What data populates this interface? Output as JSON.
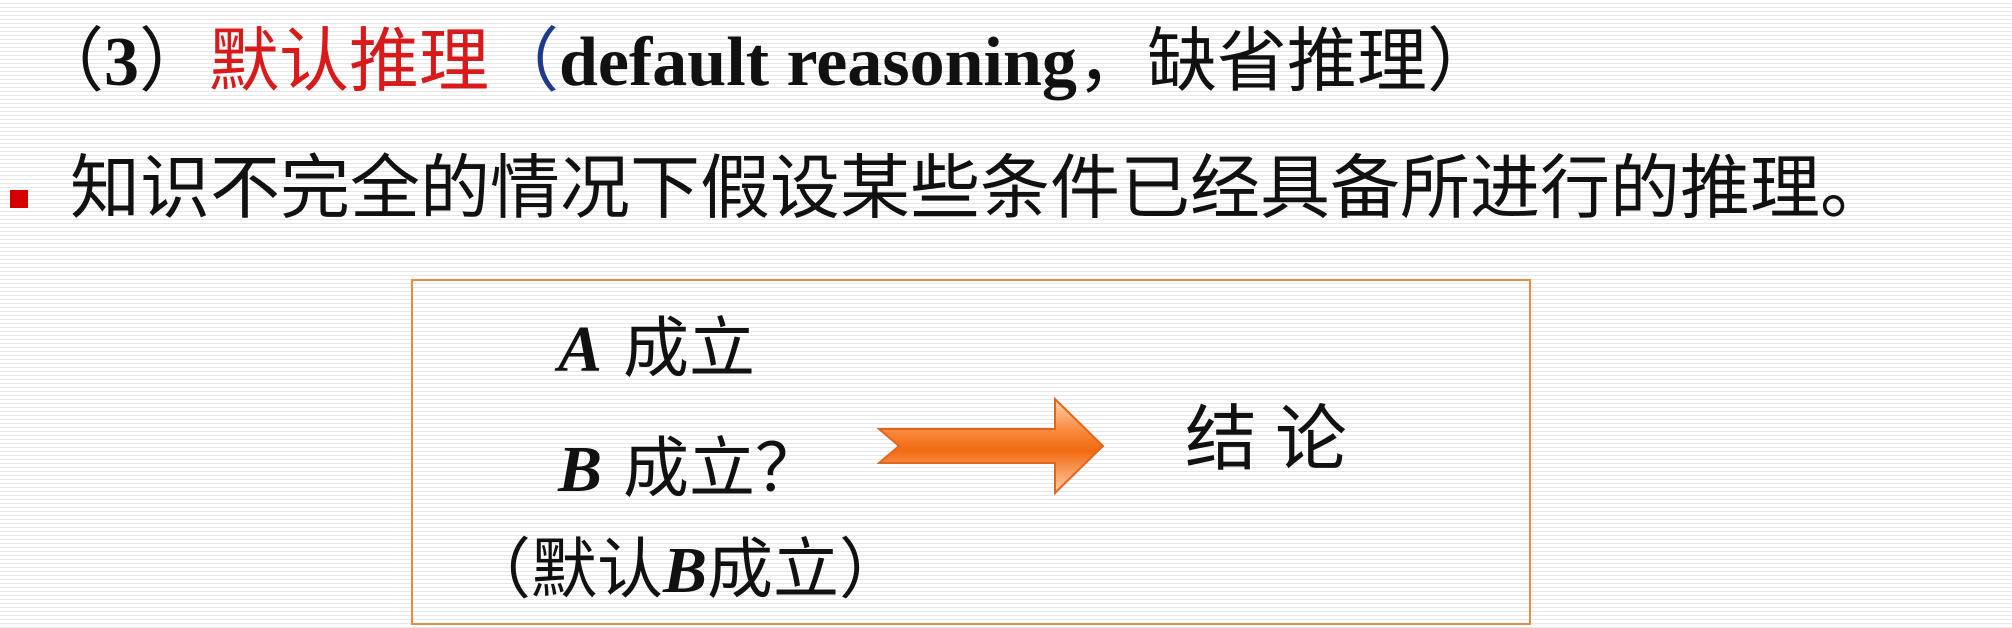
{
  "title": {
    "open_paren": "（",
    "number": "3",
    "close_paren": "）",
    "term_cn": "默认推理",
    "open_paren_blue": "（",
    "term_en": "default reasoning",
    "comma": "，",
    "alias": "缺省推理",
    "end_paren": "）"
  },
  "bullet": {
    "text": "知识不完全的情况下假设某些条件已经具备所进行的推理。"
  },
  "diagram": {
    "premise_a": {
      "var": "A",
      "text": " 成立"
    },
    "premise_b": {
      "var": "B",
      "text": " 成立？"
    },
    "premise_default": {
      "open": "（默认",
      "var": "B",
      "close": "成立）"
    },
    "conclusion": "结论"
  },
  "colors": {
    "accent_red": "#d91a1a",
    "bullet_red": "#d40000",
    "paren_blue": "#1f3a8a",
    "box_border": "#f08a3c",
    "arrow_orange": "#f26a10"
  }
}
